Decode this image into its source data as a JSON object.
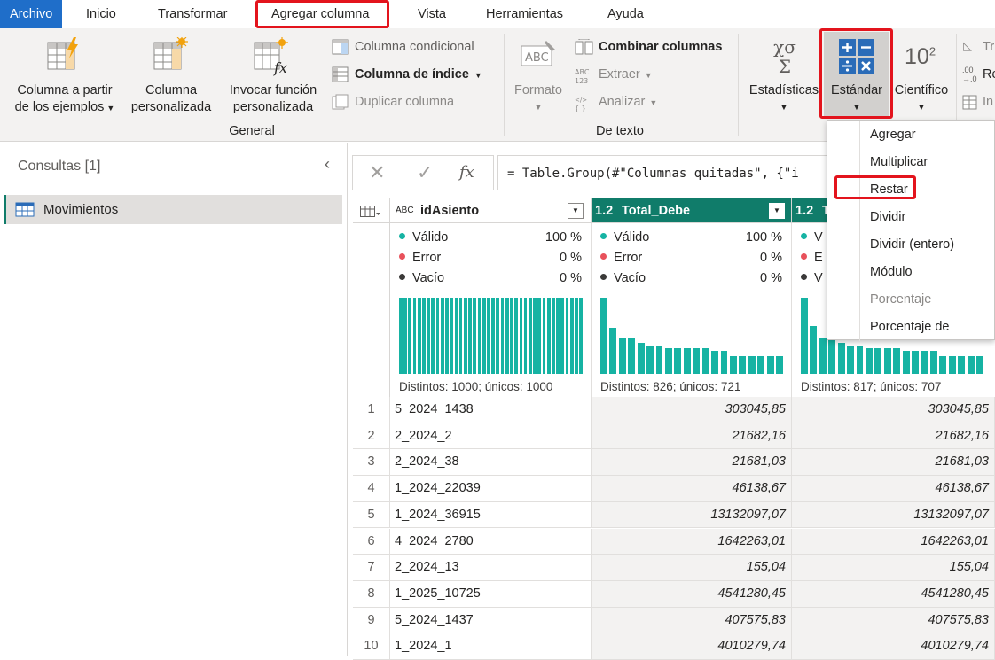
{
  "tabs": [
    {
      "label": "Archivo"
    },
    {
      "label": "Inicio"
    },
    {
      "label": "Transformar"
    },
    {
      "label": "Agregar columna"
    },
    {
      "label": "Vista"
    },
    {
      "label": "Herramientas"
    },
    {
      "label": "Ayuda"
    }
  ],
  "ribbon": {
    "general": {
      "group_label": "General",
      "col_from_examples_1": "Columna a partir",
      "col_from_examples_2": "de los ejemplos",
      "custom_col_1": "Columna",
      "custom_col_2": "personalizada",
      "invoke_fn_1": "Invocar función",
      "invoke_fn_2": "personalizada",
      "conditional": "Columna condicional",
      "index": "Columna de índice",
      "duplicate": "Duplicar columna"
    },
    "text": {
      "group_label": "De texto",
      "format": "Formato",
      "merge": "Combinar columnas",
      "extract": "Extraer",
      "parse": "Analizar"
    },
    "number": {
      "statistics": "Estadísticas",
      "standard": "Estándar",
      "scientific": "Científico",
      "scientific_glyph": "10",
      "scientific_sup": "2",
      "trig_partial": "Tr",
      "round_partial": "Re",
      "info_partial": "In",
      "round_glyph_top": ".00",
      "round_glyph_bottom": "→.0"
    }
  },
  "queries": {
    "title": "Consultas [1]",
    "items": [
      {
        "label": "Movimientos"
      }
    ]
  },
  "formula": {
    "text": "= Table.Group(#\"Columnas quitadas\", {\"i"
  },
  "columns": [
    {
      "type": "ABC",
      "name": "idAsiento",
      "valid": "Válido",
      "valid_pct": "100 %",
      "error": "Error",
      "error_pct": "0 %",
      "empty": "Vacío",
      "empty_pct": "0 %",
      "distinct": "Distintos: 1000; únicos: 1000"
    },
    {
      "type": "1.2",
      "name": "Total_Debe",
      "valid": "Válido",
      "valid_pct": "100 %",
      "error": "Error",
      "error_pct": "0 %",
      "empty": "Vacío",
      "empty_pct": "0 %",
      "distinct": "Distintos: 826; únicos: 721"
    },
    {
      "type": "1.2",
      "name": "T",
      "valid": "V",
      "error": "E",
      "empty": "V",
      "distinct": "Distintos: 817; únicos: 707"
    }
  ],
  "histograms": {
    "col1": [
      1,
      1,
      1,
      1,
      1,
      1,
      1,
      1,
      1,
      1,
      1,
      1,
      1,
      1,
      1,
      1,
      1,
      1,
      1,
      1,
      1,
      1,
      1,
      1,
      1,
      1,
      1,
      1,
      1,
      1,
      1,
      1,
      1,
      1,
      1,
      1,
      1,
      1,
      1,
      1
    ],
    "col2": [
      1,
      0.6,
      0.47,
      0.47,
      0.41,
      0.37,
      0.37,
      0.34,
      0.34,
      0.34,
      0.34,
      0.34,
      0.3,
      0.3,
      0.23,
      0.23,
      0.23,
      0.23,
      0.23,
      0.23
    ],
    "col3": [
      1,
      0.63,
      0.47,
      0.47,
      0.41,
      0.37,
      0.37,
      0.34,
      0.34,
      0.34,
      0.34,
      0.3,
      0.3,
      0.3,
      0.3,
      0.23,
      0.23,
      0.23,
      0.23,
      0.23
    ]
  },
  "rows": [
    {
      "n": "1",
      "id": "5_2024_1438",
      "debe": "303045,85",
      "haber": "303045,85"
    },
    {
      "n": "2",
      "id": "2_2024_2",
      "debe": "21682,16",
      "haber": "21682,16"
    },
    {
      "n": "3",
      "id": "2_2024_38",
      "debe": "21681,03",
      "haber": "21681,03"
    },
    {
      "n": "4",
      "id": "1_2024_22039",
      "debe": "46138,67",
      "haber": "46138,67"
    },
    {
      "n": "5",
      "id": "1_2024_36915",
      "debe": "13132097,07",
      "haber": "13132097,07"
    },
    {
      "n": "6",
      "id": "4_2024_2780",
      "debe": "1642263,01",
      "haber": "1642263,01"
    },
    {
      "n": "7",
      "id": "2_2024_13",
      "debe": "155,04",
      "haber": "155,04"
    },
    {
      "n": "8",
      "id": "1_2025_10725",
      "debe": "4541280,45",
      "haber": "4541280,45"
    },
    {
      "n": "9",
      "id": "5_2024_1437",
      "debe": "407575,83",
      "haber": "407575,83"
    },
    {
      "n": "10",
      "id": "1_2024_1",
      "debe": "4010279,74",
      "haber": "4010279,74"
    }
  ],
  "dropdown": {
    "items": [
      {
        "label": "Agregar",
        "enabled": true
      },
      {
        "label": "Multiplicar",
        "enabled": true
      },
      {
        "label": "Restar",
        "enabled": true
      },
      {
        "label": "Dividir",
        "enabled": true
      },
      {
        "label": "Dividir (entero)",
        "enabled": true
      },
      {
        "label": "Módulo",
        "enabled": true
      },
      {
        "label": "Porcentaje",
        "enabled": false
      },
      {
        "label": "Porcentaje de",
        "enabled": true
      }
    ]
  },
  "colors": {
    "accent": "#1f6ec9",
    "highlight": "#e3141d",
    "selected_header": "#107c6a",
    "bars": "#16b3a3",
    "valid_dot": "#16b3a3",
    "error_dot": "#e8515b",
    "empty_dot": "#3b3a39"
  }
}
